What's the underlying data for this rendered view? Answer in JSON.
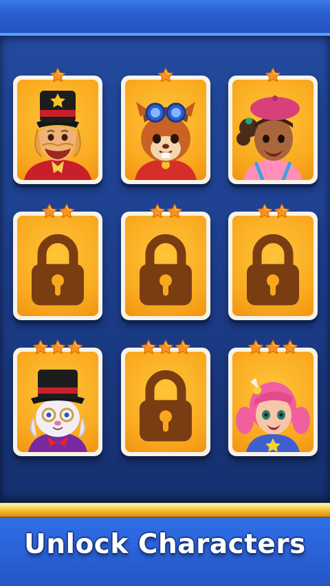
{
  "title": "Unlock Characters",
  "colors": {
    "card_orange": "#f9a81e",
    "lock_brown": "#7a3d12",
    "star_orange": "#f7931e",
    "background_blue": "#1e4090",
    "gold_bar": "#f7c33a"
  },
  "cards": [
    {
      "stars": 1,
      "locked": false,
      "character": "ringmaster-man"
    },
    {
      "stars": 1,
      "locked": false,
      "character": "squirrel-pilot"
    },
    {
      "stars": 1,
      "locked": false,
      "character": "beret-girl"
    },
    {
      "stars": 2,
      "locked": true,
      "character": "lock"
    },
    {
      "stars": 2,
      "locked": true,
      "character": "lock"
    },
    {
      "stars": 2,
      "locked": true,
      "character": "lock"
    },
    {
      "stars": 3,
      "locked": false,
      "character": "magician-rabbit"
    },
    {
      "stars": 3,
      "locked": true,
      "character": "lock"
    },
    {
      "stars": 3,
      "locked": false,
      "character": "pink-hair-girl"
    }
  ]
}
